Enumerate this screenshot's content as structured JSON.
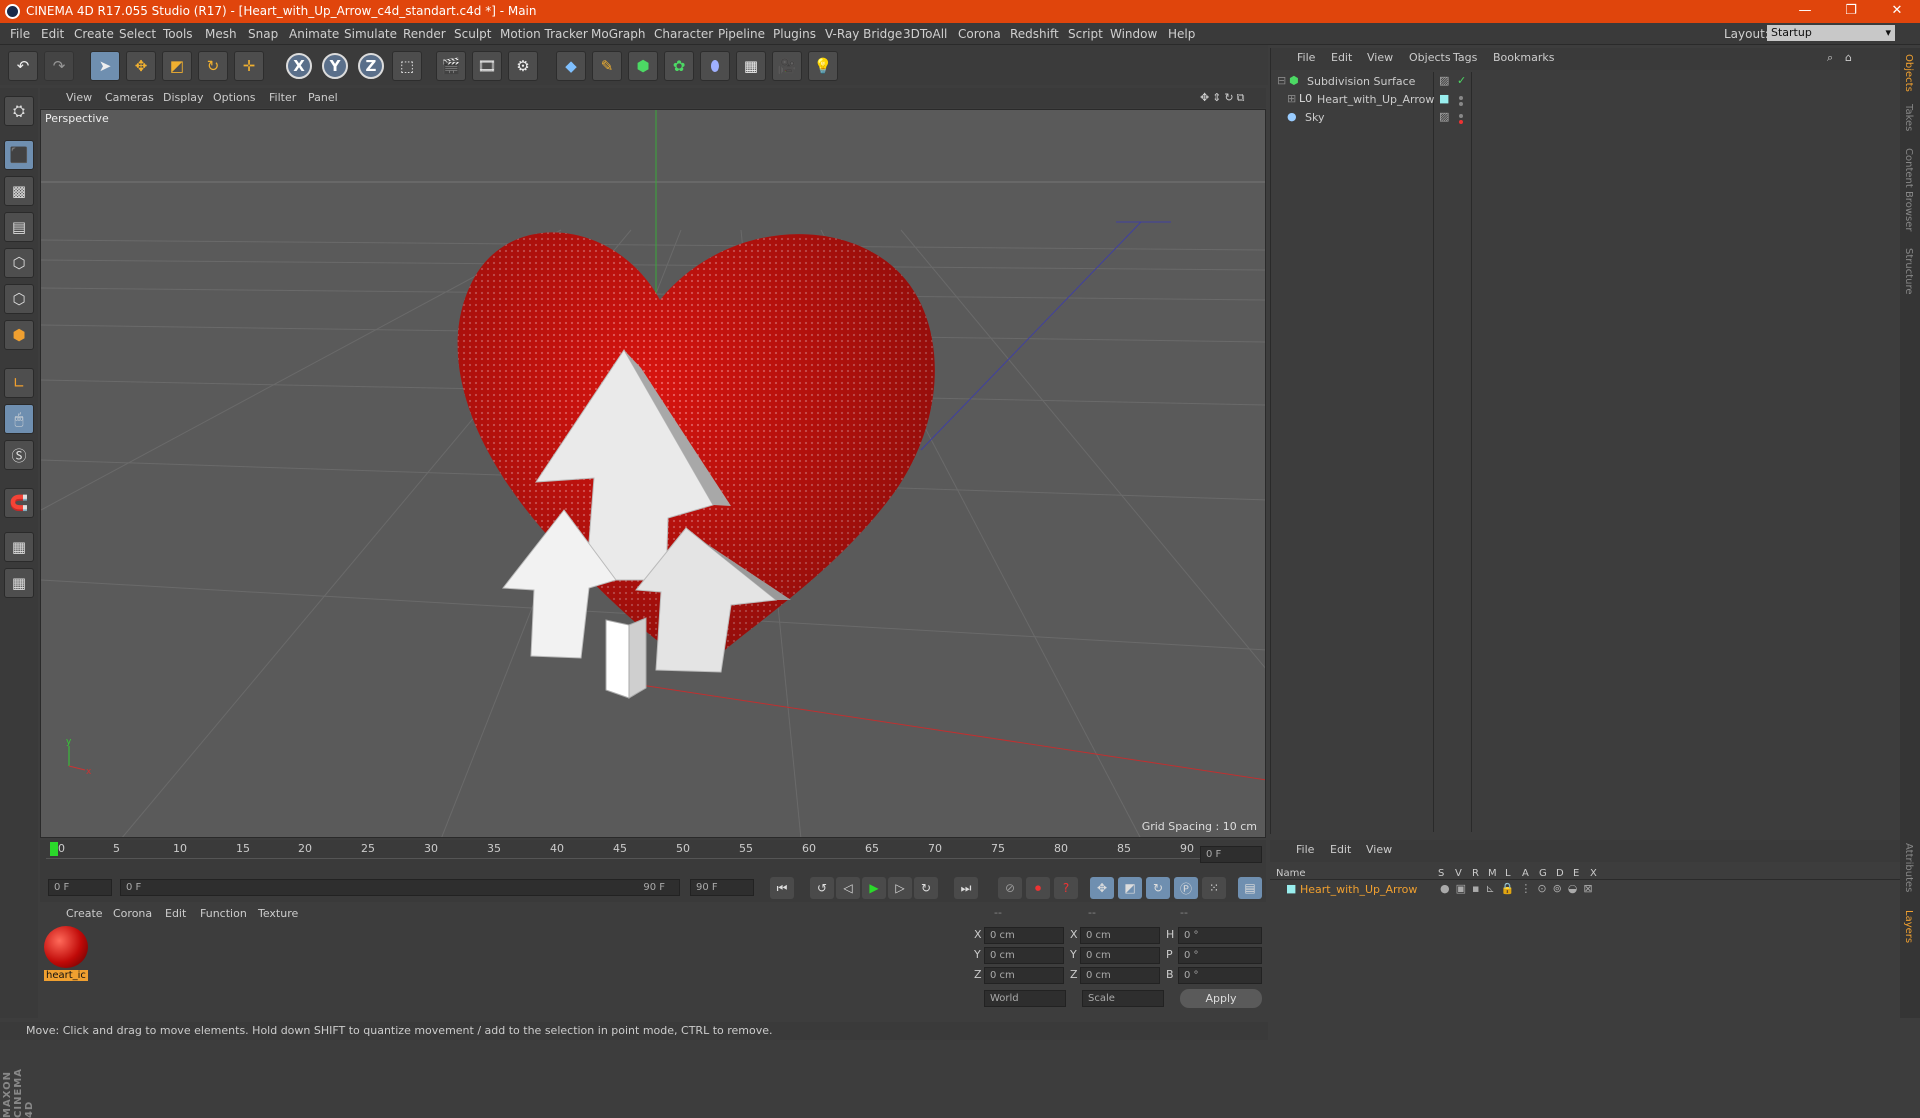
{
  "title": "CINEMA 4D R17.055 Studio (R17) - [Heart_with_Up_Arrow_c4d_standart.c4d *] - Main",
  "menu": [
    "File",
    "Edit",
    "Create",
    "Select",
    "Tools",
    "Mesh",
    "Snap",
    "Animate",
    "Simulate",
    "Render",
    "Sculpt",
    "Motion Tracker",
    "MoGraph",
    "Character",
    "Pipeline",
    "Plugins",
    "V-Ray Bridge",
    "3DToAll",
    "Corona",
    "Redshift",
    "Script",
    "Window",
    "Help"
  ],
  "layout_label": "Layout:",
  "layout_value": "Startup",
  "viewport": {
    "menu": [
      "View",
      "Cameras",
      "Display",
      "Options",
      "Filter",
      "Panel"
    ],
    "label": "Perspective",
    "grid_spacing": "Grid Spacing : 10 cm"
  },
  "timeline": {
    "ticks": [
      "0",
      "5",
      "10",
      "15",
      "20",
      "25",
      "30",
      "35",
      "40",
      "45",
      "50",
      "55",
      "60",
      "65",
      "70",
      "75",
      "80",
      "85",
      "90"
    ],
    "end_field": "0 F",
    "start": "0 F",
    "range_start": "0 F",
    "range_end": "90 F",
    "end": "90 F"
  },
  "material": {
    "menu": [
      "Create",
      "Corona",
      "Edit",
      "Function",
      "Texture"
    ],
    "name": "heart_ic"
  },
  "coords": {
    "headers": [
      "--",
      "--",
      "--"
    ],
    "rows": [
      {
        "a": "X",
        "av": "0 cm",
        "b": "X",
        "bv": "0 cm",
        "c": "H",
        "cv": "0 °"
      },
      {
        "a": "Y",
        "av": "0 cm",
        "b": "Y",
        "bv": "0 cm",
        "c": "P",
        "cv": "0 °"
      },
      {
        "a": "Z",
        "av": "0 cm",
        "b": "Z",
        "bv": "0 cm",
        "c": "B",
        "cv": "0 °"
      }
    ],
    "mode1": "World",
    "mode2": "Scale",
    "apply": "Apply"
  },
  "status": "Move: Click and drag to move elements. Hold down SHIFT to quantize movement / add to the selection in point mode, CTRL to remove.",
  "objects": {
    "menu": [
      "File",
      "Edit",
      "View",
      "Objects",
      "Tags",
      "Bookmarks"
    ],
    "items": [
      "Subdivision Surface",
      "Heart_with_Up_Arrow",
      "Sky"
    ]
  },
  "layers": {
    "menu": [
      "File",
      "Edit",
      "View"
    ],
    "name_header": "Name",
    "cols": [
      "S",
      "V",
      "R",
      "M",
      "L",
      "A",
      "G",
      "D",
      "E",
      "X"
    ],
    "item": "Heart_with_Up_Arrow"
  },
  "right_tabs": [
    "Objects",
    "Takes",
    "Content Browser",
    "Structure",
    "Attributes",
    "Layers"
  ],
  "maxon": "MAXON CINEMA 4D",
  "colors": {
    "title": "#e0450c",
    "heart": "#d8140f",
    "accent": "#f0a030"
  }
}
